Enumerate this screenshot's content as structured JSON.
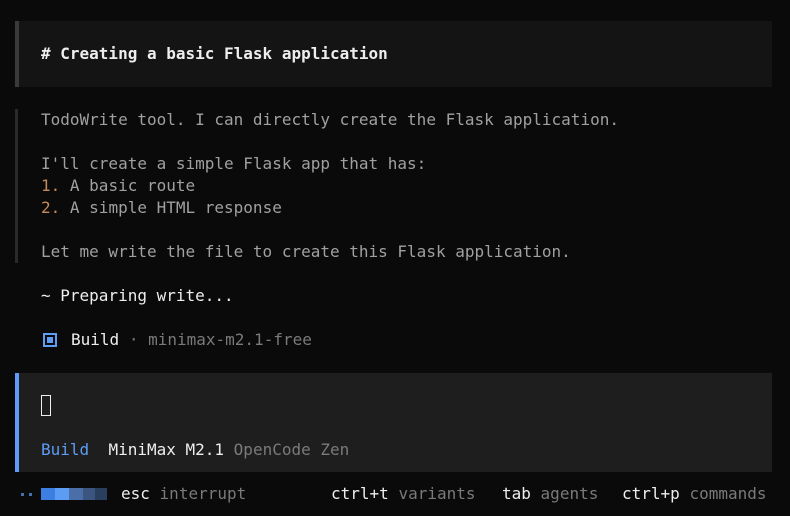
{
  "title": "# Creating a basic Flask application",
  "message": {
    "line1": "TodoWrite tool. I can directly create the Flask application.",
    "line2": "I'll create a simple Flask app that has:",
    "items": [
      {
        "num": "1.",
        "text": "A basic route"
      },
      {
        "num": "2.",
        "text": "A simple HTML response"
      }
    ],
    "line3": "Let me write the file to create this Flask application."
  },
  "status": "~ Preparing write...",
  "build_line": {
    "icon": "square-icon",
    "label": "Build",
    "separator": "·",
    "model": "minimax-m2.1-free"
  },
  "input": {
    "agent": "Build",
    "model": "MiniMax M2.1",
    "provider": "OpenCode Zen"
  },
  "footer": {
    "esc_key": "esc",
    "esc_label": "interrupt",
    "variants_key": "ctrl+t",
    "variants_label": "variants",
    "agents_key": "tab",
    "agents_label": "agents",
    "commands_key": "ctrl+p",
    "commands_label": "commands"
  },
  "colors": {
    "background": "#0a0a0a",
    "accent": "#5c9cf5",
    "list_number": "#c58a5a",
    "panel": "#1e1e1e"
  }
}
